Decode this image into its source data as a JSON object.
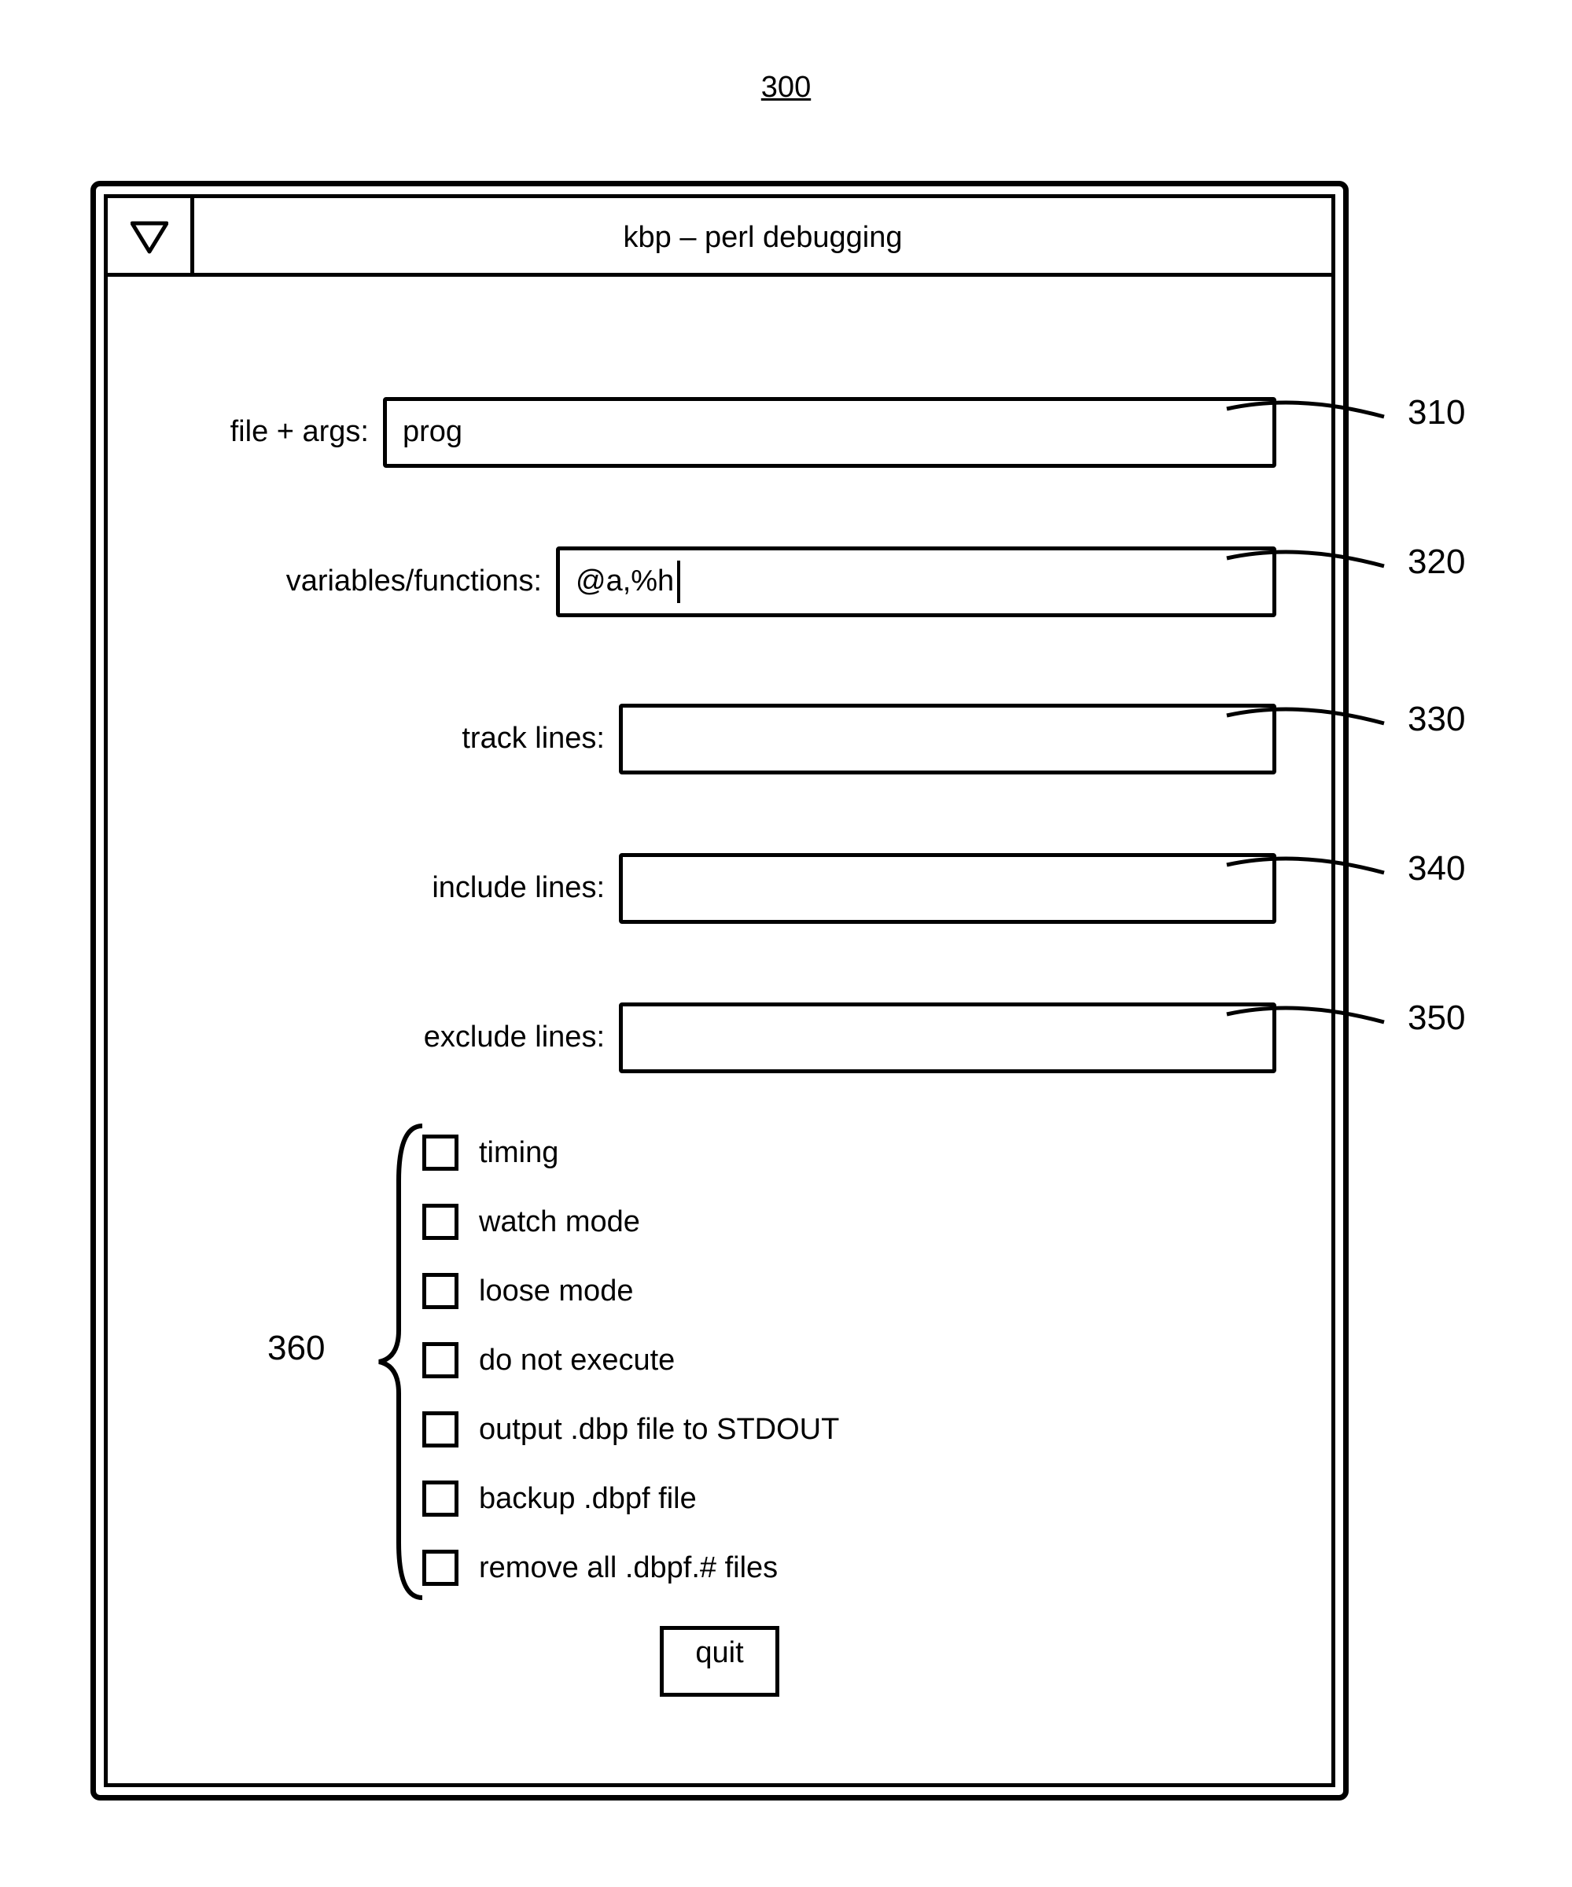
{
  "figure_number": "300",
  "window": {
    "title": "kbp – perl debugging"
  },
  "fields": {
    "file_args": {
      "label": "file + args:",
      "value": "prog"
    },
    "vars_funcs": {
      "label": "variables/functions:",
      "value": "@a,%h"
    },
    "track": {
      "label": "track lines:",
      "value": ""
    },
    "include": {
      "label": "include lines:",
      "value": ""
    },
    "exclude": {
      "label": "exclude lines:",
      "value": ""
    }
  },
  "checkboxes": [
    "timing",
    "watch mode",
    "loose mode",
    "do not execute",
    "output .dbp file to STDOUT",
    "backup .dbpf file",
    "remove all .dbpf.# files"
  ],
  "buttons": {
    "quit": "quit"
  },
  "callouts": {
    "c310": "310",
    "c320": "320",
    "c330": "330",
    "c340": "340",
    "c350": "350",
    "c360": "360"
  }
}
